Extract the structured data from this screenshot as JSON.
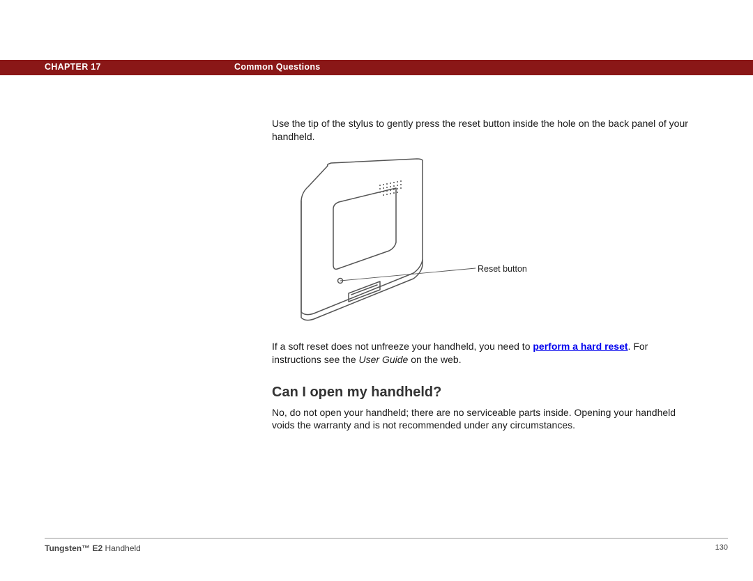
{
  "header": {
    "chapter_label": "CHAPTER 17",
    "title": "Common Questions"
  },
  "body": {
    "para1": "Use the tip of the stylus to gently press the reset button inside the hole on the back panel of your handheld.",
    "figure": {
      "callout": "Reset button"
    },
    "para2_pre": "If a soft reset does not unfreeze your handheld, you need to ",
    "para2_link": "perform a hard reset",
    "para2_post_a": ". For instructions see the ",
    "para2_italic": "User Guide",
    "para2_post_b": " on the web.",
    "section_heading": "Can I open my handheld?",
    "para3": "No, do not open your handheld; there are no serviceable parts inside. Opening your handheld voids the warranty and is not recommended under any circumstances."
  },
  "footer": {
    "brand_bold": "Tungsten™ E2",
    "brand_rest": " Handheld",
    "page_number": "130"
  }
}
